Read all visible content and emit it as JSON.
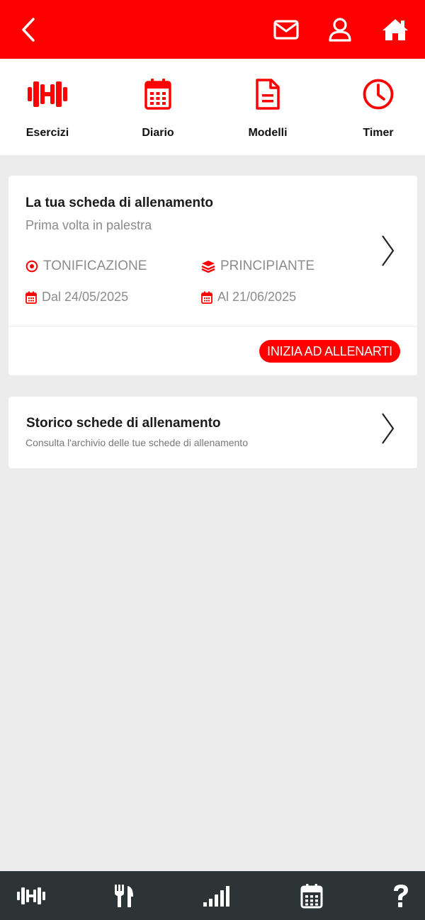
{
  "colors": {
    "accent": "#ff0000",
    "bottom_bar": "#2d3436",
    "page_background": "#ececec",
    "muted_text": "#8c8c8c"
  },
  "header": {
    "icons": [
      "back-arrow-icon",
      "mail-icon",
      "user-icon",
      "home-icon"
    ]
  },
  "quick_nav": {
    "items": [
      {
        "label": "Esercizi",
        "icon": "dumbbell-icon"
      },
      {
        "label": "Diario",
        "icon": "calendar-icon"
      },
      {
        "label": "Modelli",
        "icon": "document-icon"
      },
      {
        "label": "Timer",
        "icon": "clock-icon"
      }
    ]
  },
  "workout_card": {
    "title": "La tua scheda di allenamento",
    "subtitle": "Prima volta in palestra",
    "goal": "TONIFICAZIONE",
    "level": "PRINCIPIANTE",
    "start": "Dal 24/05/2025",
    "end": "Al 21/06/2025",
    "cta": "INIZIA AD ALLENARTI"
  },
  "history_card": {
    "title": "Storico schede di allenamento",
    "subtitle": "Consulta l'archivio delle tue schede di allenamento"
  },
  "bottom_nav": {
    "icons": [
      "dumbbell-icon",
      "fork-knife-icon",
      "signal-bars-icon",
      "calendar-icon",
      "question-icon"
    ]
  }
}
